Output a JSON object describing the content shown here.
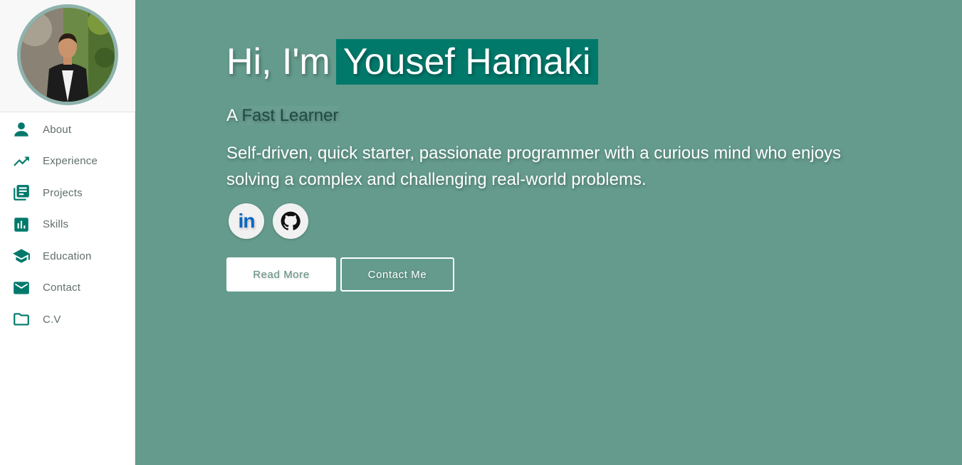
{
  "sidebar": {
    "items": [
      {
        "label": "About",
        "icon": "person-icon"
      },
      {
        "label": "Experience",
        "icon": "trending-up-icon"
      },
      {
        "label": "Projects",
        "icon": "library-books-icon"
      },
      {
        "label": "Skills",
        "icon": "bar-chart-icon"
      },
      {
        "label": "Education",
        "icon": "graduation-cap-icon"
      },
      {
        "label": "Contact",
        "icon": "mail-icon"
      },
      {
        "label": "C.V",
        "icon": "folder-icon"
      }
    ]
  },
  "hero": {
    "greeting": "Hi, I'm",
    "name": "Yousef Hamaki",
    "subtitle_prefix": "A",
    "subtitle_highlight": "Fast Learner",
    "description": "Self-driven, quick starter, passionate programmer with a curious mind who enjoys solving a complex and challenging real-world problems."
  },
  "social": {
    "linkedin_label": "in",
    "github_icon": "github-icon"
  },
  "actions": {
    "read_more": "Read More",
    "contact_me": "Contact Me"
  },
  "colors": {
    "accent": "#00796b",
    "main_bg": "#649b8c",
    "avatar_border": "#8fb3ae"
  }
}
